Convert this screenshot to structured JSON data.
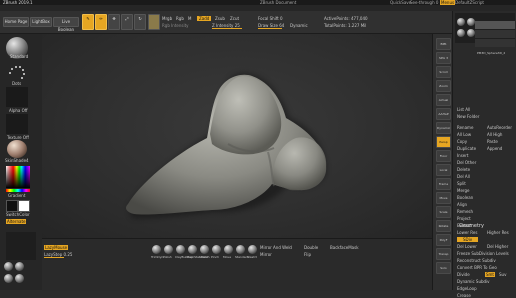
{
  "app": {
    "title": "ZBrush 2019.1",
    "doc_title": "ZBrush Document",
    "right_links": [
      "QuickSave",
      "See-through 0",
      "Menus",
      "DefaultZScript"
    ]
  },
  "menubar": [
    "Alpha",
    "Brush",
    "Color",
    "Document",
    "Draw",
    "Edit",
    "File",
    "Layer",
    "Light",
    "Macro",
    "Marker",
    "Material",
    "Movie",
    "Picker",
    "Preferences",
    "Render",
    "Stencil",
    "Stroke",
    "Texture",
    "Tool",
    "Transform",
    "ZPlugin",
    "ZScript",
    "Help"
  ],
  "toolbar": {
    "home": "Home Page",
    "lightbox": "LightBox",
    "livebooleans": "Live Boolean",
    "edit": "Edit",
    "draw": "Draw",
    "move": "Move",
    "scale": "Scale",
    "rotate": "Rotate",
    "mrgb": "Mrgb",
    "rgb": "Rgb",
    "m": "M",
    "rgb_intensity": "Rgb Intensity",
    "zadd": "Zadd",
    "zsub": "Zsub",
    "zcut": "Zcut",
    "z_intensity": "Z Intensity 25",
    "focal_shift": "Focal Shift 0",
    "draw_size": "Draw Size 64",
    "dynamic": "Dynamic",
    "active_points": "ActivePoints: 477,040",
    "total_points": "TotalPoints: 1.227 Mil"
  },
  "lefttray": {
    "brush": "Standard",
    "stroke": "Dots",
    "alpha": "Alpha Off",
    "texture": "Texture Off",
    "material": "SkinShade4",
    "gradient": "Gradient",
    "switch": "SwitchColor",
    "alternate": "Alternate"
  },
  "bottombar": {
    "lazymouse": "LazyMouse",
    "lazystep": "LazyStep 0.25",
    "tools": [
      "TrimDyn",
      "Polish",
      "ClayBuildup",
      "DamStandard",
      "hPolish",
      "Pinch",
      "Move",
      "Standard",
      "Slash3"
    ],
    "mirror_weld": "Mirror And Weld",
    "mirror": "Mirror",
    "double": "Double",
    "backface": "BackfaceMask",
    "flip": "Flip"
  },
  "rightshelf": [
    "BPR",
    "SPix 3",
    "Scroll",
    "Zoom",
    "Actual",
    "AAHalf",
    "Dynamic",
    "Persp",
    "Floor",
    "Local",
    "Frame",
    "Move",
    "Scale",
    "Rotate",
    "PolyF",
    "Transp",
    "Solo"
  ],
  "rightpanel": {
    "subtools": [
      "PM3D_Sphere3D",
      "PM3D_Sphere3D_1",
      "PM3D_Sphere3D_2"
    ],
    "list_all": "List All",
    "new_folder": "New Folder",
    "sections": [
      "Rename",
      "AutoReorder",
      "All Low",
      "All High",
      "Copy",
      "Paste",
      "Duplicate",
      "Append",
      "Insert",
      "Del Other",
      "Delete",
      "Del All",
      "Split",
      "Merge",
      "Boolean",
      "Align",
      "Remesh",
      "Project",
      "Extract"
    ],
    "geometry": "Geometry",
    "lower_res": "Lower Res",
    "higher_res": "Higher Res",
    "sdiv": "SDiv",
    "del_lower": "Del Lower",
    "del_higher": "Del Higher",
    "freeze": "Freeze SubDivision Levels",
    "reconstruct": "Reconstruct Subdiv",
    "convert": "Convert BPR To Geo",
    "divide": "Divide",
    "smt": "Smt",
    "suv": "Suv",
    "dynamic_subdiv": "Dynamic Subdiv",
    "edgeloop": "EdgeLoop",
    "crease": "Crease"
  },
  "colors": {
    "accent": "#e6a622",
    "canvas": "#2e2e2e",
    "mesh": "#8c8c85",
    "panel": "#2a2a2a"
  }
}
